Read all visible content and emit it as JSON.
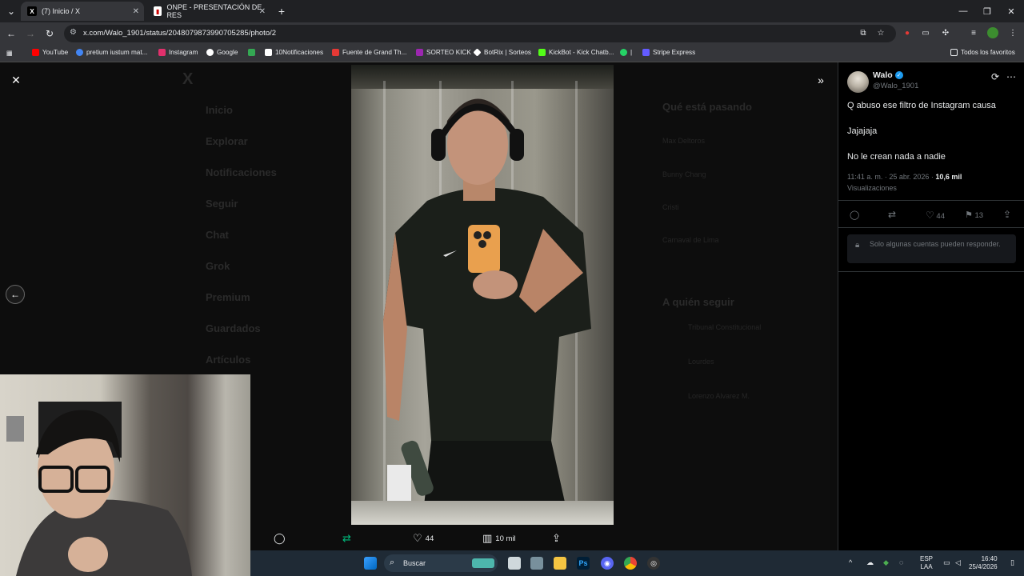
{
  "browser": {
    "tabs": [
      {
        "title": "(7) Inicio / X",
        "close": "✕"
      },
      {
        "title": "ONPE - PRESENTACIÓN DE RES",
        "close": "✕"
      }
    ],
    "new_tab": "+",
    "url": "x.com/Walo_1901/status/2048079873990705285/photo/2",
    "bookmarks": [
      {
        "label": "YouTube",
        "color": "#ff0000"
      },
      {
        "label": "pretium iustum mat...",
        "color": "#4285f4"
      },
      {
        "label": "Instagram",
        "color": "#e1306c"
      },
      {
        "label": "Google",
        "color": "#4285f4"
      },
      {
        "label": "",
        "color": "#34a853"
      },
      {
        "label": "10Notificaciones",
        "color": "#000000"
      },
      {
        "label": "Fuente de Grand Th...",
        "color": "#e53935"
      },
      {
        "label": "SORTEO KICK",
        "color": "#9c27b0"
      },
      {
        "label": "BotRix | Sorteos",
        "color": "#ffffff"
      },
      {
        "label": "KickBot - Kick Chatb...",
        "color": "#53fc18"
      },
      {
        "label": "|",
        "color": "#25d366"
      },
      {
        "label": "Stripe Express",
        "color": "#635bff"
      }
    ],
    "all_favorites": "Todos los favoritos"
  },
  "viewer": {
    "background_menu": [
      "Inicio",
      "Explorar",
      "Notificaciones",
      "Seguir",
      "Chat",
      "Grok",
      "Premium",
      "Guardados",
      "Artículos"
    ],
    "background_right": {
      "trending_title": "Qué está pasando",
      "trends": [
        "Max Deltoros",
        "Bunny Chang",
        "Cristi",
        "Carnaval de Lima"
      ],
      "follow_title": "A quién seguir",
      "follow": [
        "Tribunal Constitucional",
        "Lourdes",
        "Lorenzo Alvarez M."
      ]
    },
    "actions": {
      "reply": "",
      "retweet": "",
      "likes": "44",
      "views": "10 mil",
      "share": ""
    }
  },
  "tweet": {
    "name": "Walo",
    "handle": "@Walo_1901",
    "lines": [
      "Q abuso ese filtro de Instagram causa",
      "Jajajaja",
      "No le crean nada a nadie"
    ],
    "time": "11:41 a. m. · 25 abr. 2026 · ",
    "views_count": "10,6 mil",
    "views_label": "Visualizaciones",
    "likes": "44",
    "bookmarks": "13",
    "restricted": "Solo algunas cuentas pueden responder."
  },
  "taskbar": {
    "search_placeholder": "Buscar",
    "lang_top": "ESP",
    "lang_bottom": "LAA",
    "clock_time": "16:40",
    "clock_date": "25/4/2026"
  },
  "colors": {
    "accent": "#1d9bf0",
    "bg": "#000000",
    "chrome": "#35363a"
  }
}
